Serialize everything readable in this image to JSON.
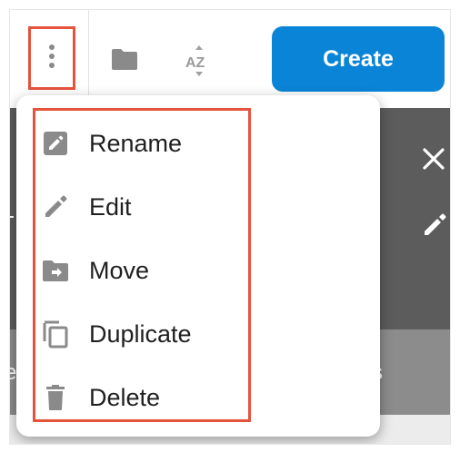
{
  "toolbar": {
    "create_label": "Create",
    "icons": [
      "more-vert-icon",
      "folder-icon",
      "sort-az-icon"
    ]
  },
  "menu": {
    "items": [
      {
        "label": "Rename",
        "icon": "rename-icon"
      },
      {
        "label": "Edit",
        "icon": "pencil-icon"
      },
      {
        "label": "Move",
        "icon": "folder-move-icon"
      },
      {
        "label": "Duplicate",
        "icon": "duplicate-icon"
      },
      {
        "label": "Delete",
        "icon": "trash-icon"
      }
    ]
  },
  "background": {
    "band_left_text": "e",
    "band_right_text": "s"
  },
  "colors": {
    "accent": "#0a84d6",
    "highlight": "#e5533d",
    "icon": "#8a8a8a",
    "dark_panel": "#5c5c5c"
  }
}
